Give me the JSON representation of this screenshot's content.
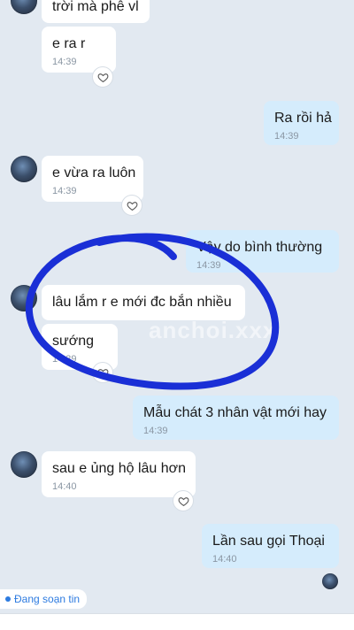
{
  "messages": [
    {
      "text": "trời mà phê vl",
      "time": ""
    },
    {
      "text": "e ra r",
      "time": "14:39"
    },
    {
      "text": "Ra rồi hả",
      "time": "14:39"
    },
    {
      "text": "e vừa ra luôn",
      "time": "14:39"
    },
    {
      "text": "Vậy do bình thường",
      "time": "14:39"
    },
    {
      "text": "lâu lắm r e mới đc bắn nhiều",
      "time": ""
    },
    {
      "text": "sướng",
      "time": "14:39"
    },
    {
      "text": "Mẫu chát 3 nhân vật mới hay",
      "time": "14:39"
    },
    {
      "text": "sau e ủng hộ lâu hơn",
      "time": "14:40"
    },
    {
      "text": "Lần sau gọi Thoại",
      "time": "14:40"
    }
  ],
  "typing_indicator": "Đang soạn tin",
  "watermark": "anchoi.xxx",
  "icons": {
    "avatar": "avatar",
    "like": "heart-icon"
  },
  "colors": {
    "background": "#e2e9f1",
    "incoming_bubble": "#ffffff",
    "outgoing_bubble": "#d5ecfc",
    "annotation_circle": "#1a2fd6"
  }
}
